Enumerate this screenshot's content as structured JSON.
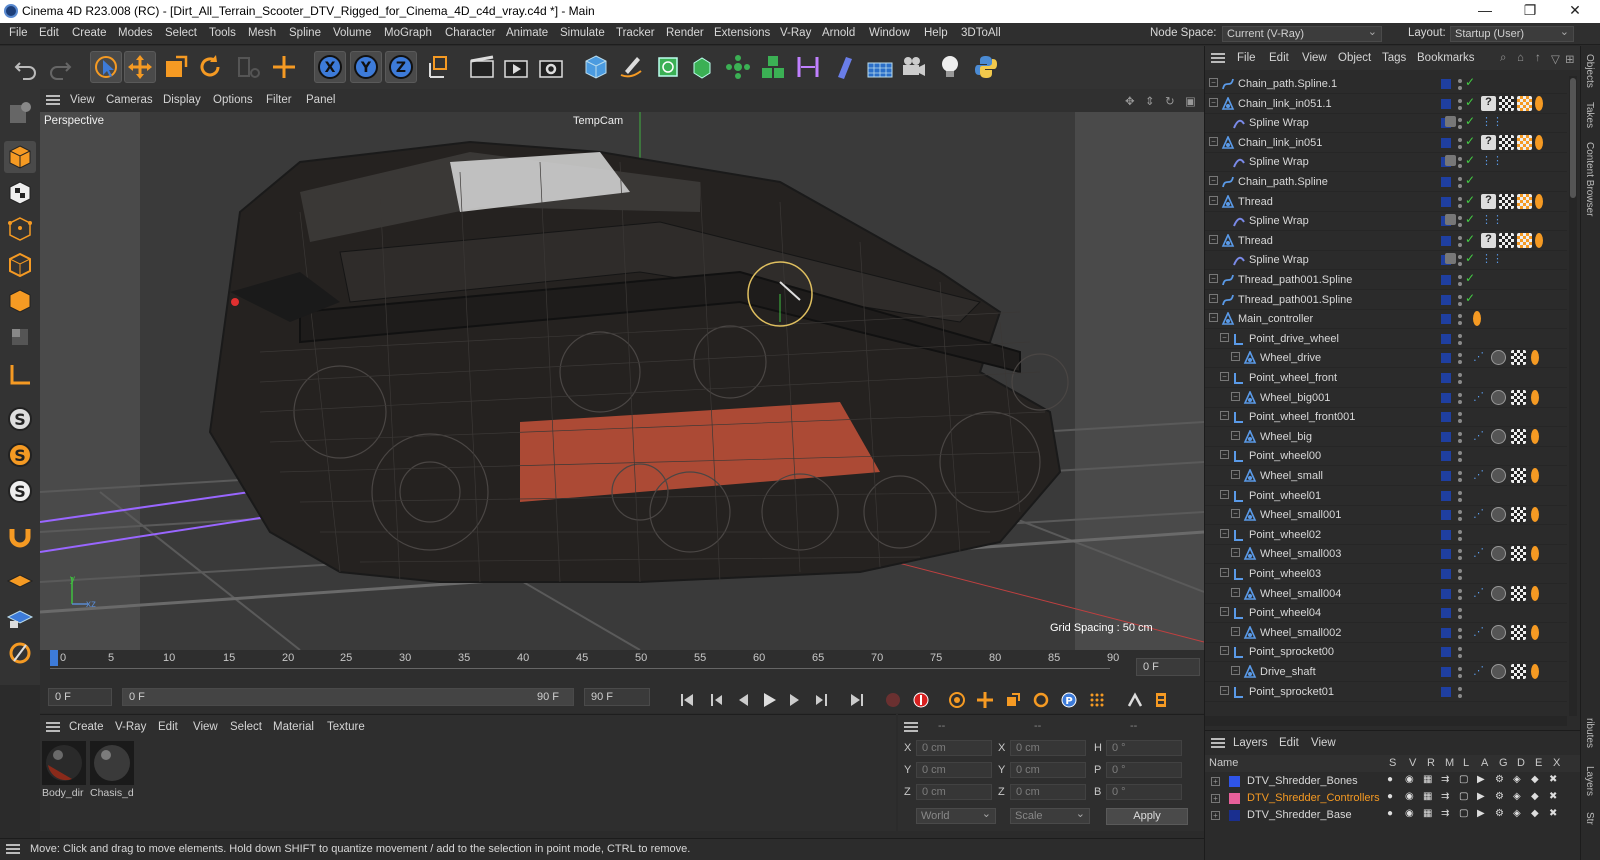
{
  "window": {
    "title": "Cinema 4D R23.008 (RC) - [Dirt_All_Terrain_Scooter_DTV_Rigged_for_Cinema_4D_c4d_vray.c4d *] - Main",
    "minimize": "—",
    "maximize": "❐",
    "close": "✕"
  },
  "menu": [
    "File",
    "Edit",
    "Create",
    "Modes",
    "Select",
    "Tools",
    "Mesh",
    "Spline",
    "Volume",
    "MoGraph",
    "Character",
    "Animate",
    "Simulate",
    "Tracker",
    "Render",
    "Extensions",
    "V-Ray",
    "Arnold",
    "Window",
    "Help",
    "3DToAll"
  ],
  "node_space": {
    "label": "Node Space:",
    "value": "Current (V-Ray)"
  },
  "layout": {
    "label": "Layout:",
    "value": "Startup (User)"
  },
  "viewport": {
    "menu": [
      "View",
      "Cameras",
      "Display",
      "Options",
      "Filter",
      "Panel"
    ],
    "view_name": "Perspective",
    "camera_label": "TempCam",
    "grid_spacing": "Grid Spacing : 50 cm",
    "axis_y": "y",
    "axis_xz": "xz"
  },
  "timeline": {
    "ticks": [
      "0",
      "5",
      "10",
      "15",
      "20",
      "25",
      "30",
      "35",
      "40",
      "45",
      "50",
      "55",
      "60",
      "65",
      "70",
      "75",
      "80",
      "85",
      "90"
    ],
    "current_frame": "0 F",
    "start": "0 F",
    "range_start": "0 F",
    "range_end": "90 F",
    "end": "90 F"
  },
  "material_panel": {
    "menu": [
      "Create",
      "V-Ray",
      "Edit",
      "View",
      "Select",
      "Material",
      "Texture"
    ],
    "materials": [
      {
        "name": "Body_dir"
      },
      {
        "name": "Chasis_d"
      }
    ]
  },
  "coord_panel": {
    "header": [
      "--",
      "--",
      "--"
    ],
    "rows": [
      {
        "a": "X",
        "av": "0 cm",
        "b": "X",
        "bv": "0 cm",
        "c": "H",
        "cv": "0 °"
      },
      {
        "a": "Y",
        "av": "0 cm",
        "b": "Y",
        "bv": "0 cm",
        "c": "P",
        "cv": "0 °"
      },
      {
        "a": "Z",
        "av": "0 cm",
        "b": "Z",
        "bv": "0 cm",
        "c": "B",
        "cv": "0 °"
      }
    ],
    "mode": "World",
    "scale": "Scale",
    "apply": "Apply"
  },
  "status": "Move: Click and drag to move elements. Hold down SHIFT to quantize movement / add to the selection in point mode, CTRL to remove.",
  "objects_panel": {
    "menu": [
      "File",
      "Edit",
      "View",
      "Object",
      "Tags",
      "Bookmarks"
    ],
    "items": [
      {
        "name": "Chain_path.Spline.1",
        "icon": "spline",
        "depth": 0
      },
      {
        "name": "Chain_link_in051.1",
        "icon": "null",
        "depth": 0
      },
      {
        "name": "Spline Wrap",
        "icon": "deformer",
        "depth": 1
      },
      {
        "name": "Chain_link_in051",
        "icon": "null",
        "depth": 0
      },
      {
        "name": "Spline Wrap",
        "icon": "deformer",
        "depth": 1
      },
      {
        "name": "Chain_path.Spline",
        "icon": "spline",
        "depth": 0
      },
      {
        "name": "Thread",
        "icon": "null",
        "depth": 0
      },
      {
        "name": "Spline Wrap",
        "icon": "deformer",
        "depth": 1
      },
      {
        "name": "Thread",
        "icon": "null",
        "depth": 0
      },
      {
        "name": "Spline Wrap",
        "icon": "deformer",
        "depth": 1
      },
      {
        "name": "Thread_path001.Spline",
        "icon": "spline",
        "depth": 0
      },
      {
        "name": "Thread_path001.Spline",
        "icon": "spline",
        "depth": 0
      },
      {
        "name": "Main_controller",
        "icon": "null",
        "depth": 0
      },
      {
        "name": "Point_drive_wheel",
        "icon": "bone",
        "depth": 1
      },
      {
        "name": "Wheel_drive",
        "icon": "null",
        "depth": 2
      },
      {
        "name": "Point_wheel_front",
        "icon": "bone",
        "depth": 1
      },
      {
        "name": "Wheel_big001",
        "icon": "null",
        "depth": 2
      },
      {
        "name": "Point_wheel_front001",
        "icon": "bone",
        "depth": 1
      },
      {
        "name": "Wheel_big",
        "icon": "null",
        "depth": 2
      },
      {
        "name": "Point_wheel00",
        "icon": "bone",
        "depth": 1
      },
      {
        "name": "Wheel_small",
        "icon": "null",
        "depth": 2
      },
      {
        "name": "Point_wheel01",
        "icon": "bone",
        "depth": 1
      },
      {
        "name": "Wheel_small001",
        "icon": "null",
        "depth": 2
      },
      {
        "name": "Point_wheel02",
        "icon": "bone",
        "depth": 1
      },
      {
        "name": "Wheel_small003",
        "icon": "null",
        "depth": 2
      },
      {
        "name": "Point_wheel03",
        "icon": "bone",
        "depth": 1
      },
      {
        "name": "Wheel_small004",
        "icon": "null",
        "depth": 2
      },
      {
        "name": "Point_wheel04",
        "icon": "bone",
        "depth": 1
      },
      {
        "name": "Wheel_small002",
        "icon": "null",
        "depth": 2
      },
      {
        "name": "Point_sprocket00",
        "icon": "bone",
        "depth": 1
      },
      {
        "name": "Drive_shaft",
        "icon": "null",
        "depth": 2
      },
      {
        "name": "Point_sprocket01",
        "icon": "bone",
        "depth": 1
      }
    ]
  },
  "layers_panel": {
    "menu": [
      "Layers",
      "Edit",
      "View"
    ],
    "header_name": "Name",
    "columns": [
      "S",
      "V",
      "R",
      "M",
      "L",
      "A",
      "G",
      "D",
      "E",
      "X"
    ],
    "layers": [
      {
        "name": "DTV_Shredder_Bones",
        "color": "#2f54e8"
      },
      {
        "name": "DTV_Shredder_Controllers",
        "color": "#e8609a"
      },
      {
        "name": "DTV_Shredder_Base",
        "color": "#1a2f8f"
      }
    ]
  },
  "side_tabs": [
    "Objects",
    "Takes",
    "Content Browser",
    "ributes",
    "Layers",
    "Str"
  ],
  "colors": {
    "accent": "#f59a23",
    "selection_blue": "#3d7bd9",
    "check_green": "#44cc44"
  }
}
